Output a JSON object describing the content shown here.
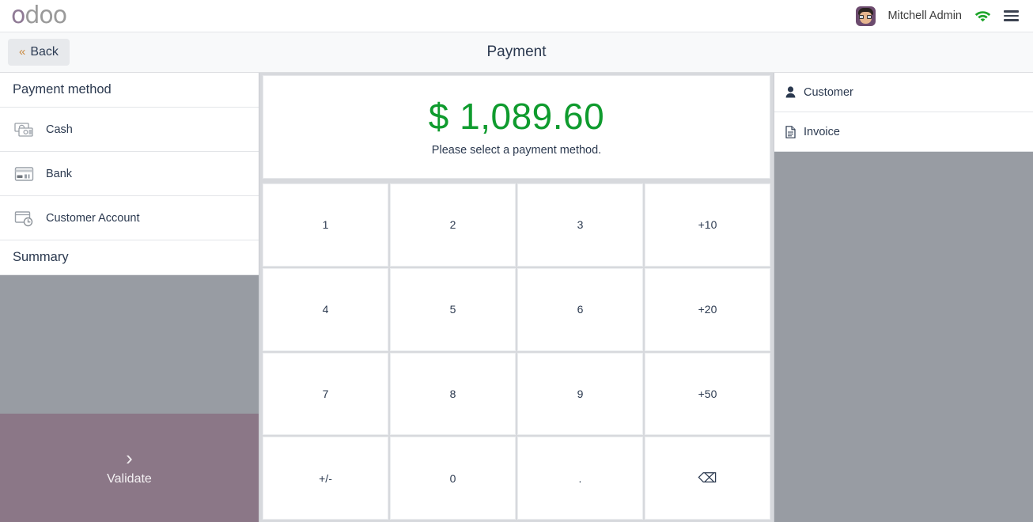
{
  "app": {
    "logo_first": "o",
    "logo_rest": "doo"
  },
  "topbar": {
    "username": "Mitchell Admin",
    "avatar_name": "user-avatar",
    "wifi_icon": "wifi-icon",
    "wifi_color": "#1fa52b",
    "menu_icon": "hamburger-menu-icon"
  },
  "subheader": {
    "back_chevron": "«",
    "back_label": "Back",
    "title": "Payment"
  },
  "left": {
    "payment_method_title": "Payment method",
    "methods": [
      {
        "label": "Cash",
        "icon": "cash-icon"
      },
      {
        "label": "Bank",
        "icon": "credit-card-icon"
      },
      {
        "label": "Customer Account",
        "icon": "customer-account-icon"
      }
    ],
    "summary_title": "Summary",
    "validate": {
      "chevron": "›",
      "label": "Validate"
    }
  },
  "center": {
    "amount": "$ 1,089.60",
    "amount_color": "#0f9b2e",
    "hint": "Please select a payment method.",
    "numpad": [
      {
        "label": "1",
        "name": "numpad-key-1"
      },
      {
        "label": "2",
        "name": "numpad-key-2"
      },
      {
        "label": "3",
        "name": "numpad-key-3"
      },
      {
        "label": "+10",
        "name": "numpad-key-plus-10"
      },
      {
        "label": "4",
        "name": "numpad-key-4"
      },
      {
        "label": "5",
        "name": "numpad-key-5"
      },
      {
        "label": "6",
        "name": "numpad-key-6"
      },
      {
        "label": "+20",
        "name": "numpad-key-plus-20"
      },
      {
        "label": "7",
        "name": "numpad-key-7"
      },
      {
        "label": "8",
        "name": "numpad-key-8"
      },
      {
        "label": "9",
        "name": "numpad-key-9"
      },
      {
        "label": "+50",
        "name": "numpad-key-plus-50"
      },
      {
        "label": "+/-",
        "name": "numpad-key-sign"
      },
      {
        "label": "0",
        "name": "numpad-key-0"
      },
      {
        "label": ".",
        "name": "numpad-key-decimal"
      },
      {
        "label": "⌫",
        "name": "numpad-key-backspace"
      }
    ]
  },
  "right": {
    "rows": [
      {
        "label": "Customer",
        "icon": "person-icon"
      },
      {
        "label": "Invoice",
        "icon": "document-icon"
      }
    ]
  }
}
